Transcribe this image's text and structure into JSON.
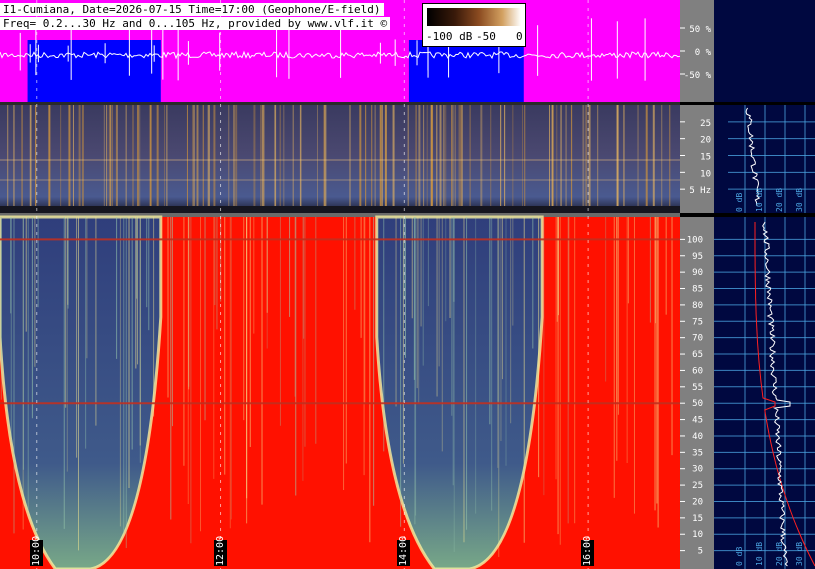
{
  "header": {
    "line1": "I1-Cumiana, Date=2026-07-15 Time=17:00 (Geophone/E-field)",
    "line2": "Freq= 0.2...30 Hz and 0...105 Hz, provided by www.vlf.it ©"
  },
  "colorbar": {
    "labels": [
      "-100 dB",
      "-50",
      "0"
    ]
  },
  "chart_data": [
    {
      "type": "line",
      "title": "",
      "panel": "waveform amplitude",
      "y_ticks": [
        "50 %",
        "0 %",
        "-50 %"
      ],
      "ylim": [
        -100,
        100
      ],
      "background_colors": {
        "quiet": "#ff00ff",
        "active": "#0000ff"
      },
      "active_intervals_hours": [
        [
          9.9,
          11.35
        ],
        [
          14.05,
          15.3
        ]
      ]
    },
    {
      "type": "heatmap",
      "panel": "low-frequency spectrogram",
      "y_ticks": [
        "25",
        "20",
        "15",
        "10",
        "5 Hz"
      ],
      "ylim": [
        0,
        30
      ],
      "unit": "Hz"
    },
    {
      "type": "heatmap",
      "panel": "main spectrogram",
      "y_ticks": [
        "100",
        "95",
        "90",
        "85",
        "80",
        "75",
        "70",
        "65",
        "60",
        "55",
        "50",
        "45",
        "40",
        "35",
        "30",
        "25",
        "20",
        "15",
        "10",
        "5"
      ],
      "ylim": [
        0,
        105
      ],
      "x_ticks": [
        "10:00",
        "12:00",
        "14:00",
        "16:00"
      ],
      "x_tick_hours": [
        10,
        12,
        14,
        16
      ],
      "xlim_hours": [
        9.6,
        17.0
      ],
      "line_frequencies_hz": [
        50,
        100
      ],
      "quiet_intervals_hours": [
        [
          9.6,
          11.35
        ],
        [
          13.7,
          15.5
        ]
      ]
    },
    {
      "type": "line",
      "panel": "spectrum profile upper",
      "x_ticks": [
        "0 dB",
        "10 dB",
        "20 dB",
        "30 dB"
      ],
      "ylim": [
        0,
        30
      ]
    },
    {
      "type": "line",
      "panel": "spectrum profile lower",
      "x_ticks": [
        "0 dB",
        "10 dB",
        "20 dB",
        "30 dB"
      ],
      "ylim": [
        0,
        105
      ],
      "peak_hz": 50
    }
  ],
  "colors": {
    "magenta": "#ff00ff",
    "blue": "#0000ff",
    "red": "#ff1100",
    "spec_dark": "#35467f",
    "grid": "#4aa3e0",
    "navy": "#000840",
    "scale_gray": "#808080"
  }
}
